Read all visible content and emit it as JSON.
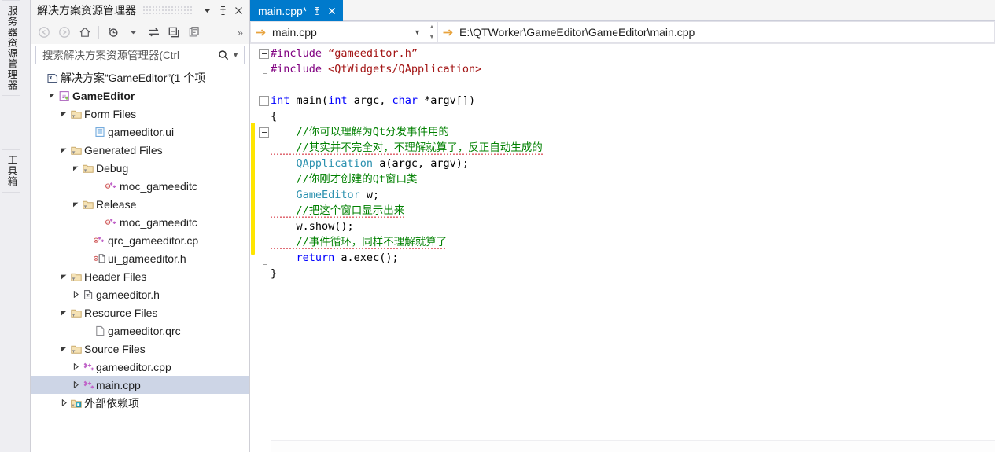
{
  "dock": {
    "tabs": [
      {
        "name": "server-explorer",
        "label": "服务器资源管理器"
      },
      {
        "name": "toolbox",
        "label": "工具箱"
      }
    ]
  },
  "solution_explorer": {
    "title": "解决方案资源管理器",
    "header_buttons": [
      {
        "name": "dropdown",
        "icon": "chevron-down-icon"
      },
      {
        "name": "pin",
        "icon": "pin-icon"
      },
      {
        "name": "close",
        "icon": "close-icon"
      }
    ],
    "toolbar": [
      {
        "name": "back",
        "icon": "back-arrow-icon",
        "enabled": false
      },
      {
        "name": "forward",
        "icon": "forward-arrow-icon",
        "enabled": false
      },
      {
        "name": "home",
        "icon": "home-icon",
        "enabled": true
      },
      {
        "name": "pending-changes",
        "icon": "clock-filter-icon",
        "enabled": true
      },
      {
        "name": "sync-with-active-document",
        "icon": "sync-arrows-icon",
        "enabled": true
      },
      {
        "name": "collapse-all",
        "icon": "collapse-all-icon",
        "enabled": true
      },
      {
        "name": "show-all-files",
        "icon": "show-all-files-icon",
        "enabled": true
      }
    ],
    "overflow_label": "»",
    "search": {
      "placeholder": "搜索解决方案资源管理器(Ctrl",
      "value": ""
    },
    "tree": [
      {
        "label": "解决方案“GameEditor”(1 个项",
        "indent": 0,
        "twisty": "none",
        "icon": "solution-icon",
        "bold": false,
        "selected": false
      },
      {
        "label": "GameEditor",
        "indent": 1,
        "twisty": "expanded",
        "icon": "project-icon",
        "bold": true,
        "selected": false
      },
      {
        "label": "Form Files",
        "indent": 2,
        "twisty": "expanded",
        "icon": "filter-folder-icon",
        "bold": false,
        "selected": false
      },
      {
        "label": "gameeditor.ui",
        "indent": 4,
        "twisty": "none",
        "icon": "ui-file-icon",
        "bold": false,
        "selected": false
      },
      {
        "label": "Generated Files",
        "indent": 2,
        "twisty": "expanded",
        "icon": "filter-folder-icon",
        "bold": false,
        "selected": false
      },
      {
        "label": "Debug",
        "indent": 3,
        "twisty": "expanded",
        "icon": "filter-folder-icon",
        "bold": false,
        "selected": false
      },
      {
        "label": "moc_gameeditc",
        "indent": 5,
        "twisty": "none",
        "icon": "cpp-file-excluded-icon",
        "bold": false,
        "selected": false
      },
      {
        "label": "Release",
        "indent": 3,
        "twisty": "expanded",
        "icon": "filter-folder-icon",
        "bold": false,
        "selected": false
      },
      {
        "label": "moc_gameeditc",
        "indent": 5,
        "twisty": "none",
        "icon": "cpp-file-excluded-icon",
        "bold": false,
        "selected": false
      },
      {
        "label": "qrc_gameeditor.cp",
        "indent": 4,
        "twisty": "none",
        "icon": "cpp-file-excluded-icon",
        "bold": false,
        "selected": false
      },
      {
        "label": "ui_gameeditor.h",
        "indent": 4,
        "twisty": "none",
        "icon": "h-file-excluded-icon",
        "bold": false,
        "selected": false
      },
      {
        "label": "Header Files",
        "indent": 2,
        "twisty": "expanded",
        "icon": "filter-folder-icon",
        "bold": false,
        "selected": false
      },
      {
        "label": "gameeditor.h",
        "indent": 3,
        "twisty": "collapsed",
        "icon": "h-file-icon",
        "bold": false,
        "selected": false
      },
      {
        "label": "Resource Files",
        "indent": 2,
        "twisty": "expanded",
        "icon": "filter-folder-icon",
        "bold": false,
        "selected": false
      },
      {
        "label": "gameeditor.qrc",
        "indent": 4,
        "twisty": "none",
        "icon": "generic-file-icon",
        "bold": false,
        "selected": false
      },
      {
        "label": "Source Files",
        "indent": 2,
        "twisty": "expanded",
        "icon": "filter-folder-icon",
        "bold": false,
        "selected": false
      },
      {
        "label": "gameeditor.cpp",
        "indent": 3,
        "twisty": "collapsed",
        "icon": "cpp-file-icon",
        "bold": false,
        "selected": false
      },
      {
        "label": "main.cpp",
        "indent": 3,
        "twisty": "collapsed",
        "icon": "cpp-file-icon",
        "bold": false,
        "selected": true
      },
      {
        "label": "外部依赖项",
        "indent": 2,
        "twisty": "collapsed",
        "icon": "external-dependencies-icon",
        "bold": false,
        "selected": false
      }
    ]
  },
  "editor": {
    "tab": {
      "label": "main.cpp*",
      "pin_icon": "pin-icon",
      "close_icon": "close-icon",
      "active_color": "#007ACC"
    },
    "navbar": {
      "file": "main.cpp",
      "path": "E:\\QTWorker\\GameEditor\\GameEditor\\main.cpp",
      "arrow_icon": "forward-arrow-icon",
      "caret_icon": "chevron-down-icon"
    },
    "change_marker_color": "#FFE500",
    "lines": [
      {
        "n": 1,
        "fold": "minus",
        "tokens": [
          {
            "t": "#include ",
            "c": "pp"
          },
          {
            "t": "“gameeditor.h”",
            "c": "str"
          }
        ]
      },
      {
        "n": 2,
        "fold": "end",
        "tokens": [
          {
            "t": "#include ",
            "c": "pp"
          },
          {
            "t": "<QtWidgets/QApplication>",
            "c": "str"
          }
        ]
      },
      {
        "n": 3,
        "fold": "none",
        "tokens": []
      },
      {
        "n": 4,
        "fold": "minus",
        "tokens": [
          {
            "t": "int",
            "c": "kw"
          },
          {
            "t": " ",
            "c": "pl"
          },
          {
            "t": "main",
            "c": "pl"
          },
          {
            "t": "(",
            "c": "pl"
          },
          {
            "t": "int",
            "c": "kw"
          },
          {
            "t": " argc, ",
            "c": "pl"
          },
          {
            "t": "char",
            "c": "kw"
          },
          {
            "t": " *argv[])",
            "c": "pl"
          }
        ]
      },
      {
        "n": 5,
        "fold": "none",
        "tokens": [
          {
            "t": "{",
            "c": "pl"
          }
        ]
      },
      {
        "n": 6,
        "fold": "minus",
        "tokens": [
          {
            "t": "    //你可以理解为Qt分发事件用的",
            "c": "cm"
          }
        ]
      },
      {
        "n": 7,
        "fold": "none",
        "tokens": [
          {
            "t": "    //其实并不完全对，不理解就算了，反正自动生成的",
            "c": "cm",
            "squiggle": true
          }
        ]
      },
      {
        "n": 8,
        "fold": "none",
        "tokens": [
          {
            "t": "    ",
            "c": "pl"
          },
          {
            "t": "QApplication",
            "c": "ty"
          },
          {
            "t": " a(argc, argv);",
            "c": "pl"
          }
        ]
      },
      {
        "n": 9,
        "fold": "none",
        "tokens": [
          {
            "t": "    //你刚才创建的Qt窗口类",
            "c": "cm"
          }
        ]
      },
      {
        "n": 10,
        "fold": "none",
        "tokens": [
          {
            "t": "    ",
            "c": "pl"
          },
          {
            "t": "GameEditor",
            "c": "ty"
          },
          {
            "t": " w;",
            "c": "pl"
          }
        ]
      },
      {
        "n": 11,
        "fold": "none",
        "tokens": [
          {
            "t": "    //把这个窗口显示出来",
            "c": "cm",
            "squiggle": true
          }
        ]
      },
      {
        "n": 12,
        "fold": "none",
        "tokens": [
          {
            "t": "    w.show();",
            "c": "pl"
          }
        ]
      },
      {
        "n": 13,
        "fold": "none",
        "tokens": [
          {
            "t": "    //事件循环，同样不理解就算了",
            "c": "cm",
            "squiggle": true
          }
        ]
      },
      {
        "n": 14,
        "fold": "none",
        "tokens": [
          {
            "t": "    ",
            "c": "pl"
          },
          {
            "t": "return",
            "c": "kw"
          },
          {
            "t": " a.exec();",
            "c": "pl"
          }
        ]
      },
      {
        "n": 15,
        "fold": "none",
        "tokens": [
          {
            "t": "}",
            "c": "pl"
          }
        ]
      }
    ]
  }
}
